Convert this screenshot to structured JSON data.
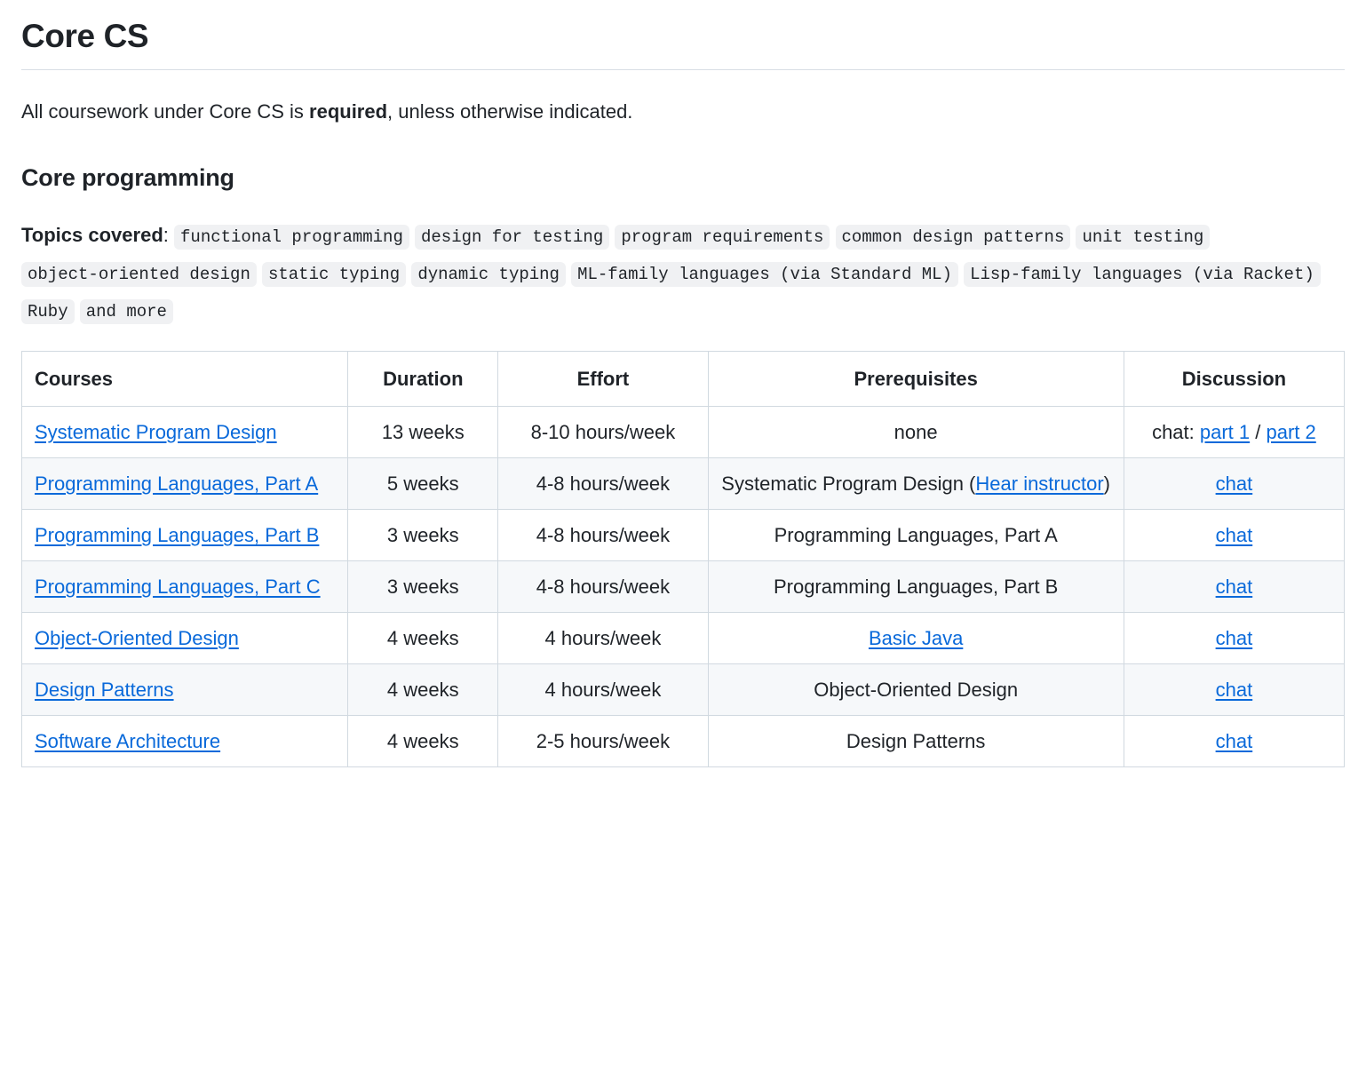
{
  "page": {
    "title": "Core CS",
    "intro_before": "All coursework under Core CS is ",
    "intro_strong": "required",
    "intro_after": ", unless otherwise indicated.",
    "section_title": "Core programming"
  },
  "topics": {
    "label": "Topics covered",
    "separator": ":",
    "tags": [
      "functional programming",
      "design for testing",
      "program requirements",
      "common design patterns",
      "unit testing",
      "object-oriented design",
      "static typing",
      "dynamic typing",
      "ML-family languages (via Standard ML)",
      "Lisp-family languages (via Racket)",
      "Ruby",
      "and more"
    ]
  },
  "table": {
    "headers": [
      "Courses",
      "Duration",
      "Effort",
      "Prerequisites",
      "Discussion"
    ],
    "rows": [
      {
        "course": "Systematic Program Design",
        "duration": "13 weeks",
        "effort": "8-10 hours/week",
        "prereq_text": "none",
        "prereq_link_before": "",
        "prereq_link": "",
        "prereq_link_after": "",
        "discussion_prefix": "chat: ",
        "discussion_link1": "part 1",
        "discussion_middle": " / ",
        "discussion_link2": "part 2"
      },
      {
        "course": "Programming Languages, Part A",
        "duration": "5 weeks",
        "effort": "4-8 hours/week",
        "prereq_text": "",
        "prereq_link_before": "Systematic Program Design (",
        "prereq_link": "Hear instructor",
        "prereq_link_after": ")",
        "discussion_prefix": "",
        "discussion_link1": "chat",
        "discussion_middle": "",
        "discussion_link2": ""
      },
      {
        "course": "Programming Languages, Part B",
        "duration": "3 weeks",
        "effort": "4-8 hours/week",
        "prereq_text": "Programming Languages, Part A",
        "prereq_link_before": "",
        "prereq_link": "",
        "prereq_link_after": "",
        "discussion_prefix": "",
        "discussion_link1": "chat",
        "discussion_middle": "",
        "discussion_link2": ""
      },
      {
        "course": "Programming Languages, Part C",
        "duration": "3 weeks",
        "effort": "4-8 hours/week",
        "prereq_text": "Programming Languages, Part B",
        "prereq_link_before": "",
        "prereq_link": "",
        "prereq_link_after": "",
        "discussion_prefix": "",
        "discussion_link1": "chat",
        "discussion_middle": "",
        "discussion_link2": ""
      },
      {
        "course": "Object-Oriented Design",
        "duration": "4 weeks",
        "effort": "4 hours/week",
        "prereq_text": "",
        "prereq_link_before": "",
        "prereq_link": "Basic Java",
        "prereq_link_after": "",
        "discussion_prefix": "",
        "discussion_link1": "chat",
        "discussion_middle": "",
        "discussion_link2": ""
      },
      {
        "course": "Design Patterns",
        "duration": "4 weeks",
        "effort": "4 hours/week",
        "prereq_text": "Object-Oriented Design",
        "prereq_link_before": "",
        "prereq_link": "",
        "prereq_link_after": "",
        "discussion_prefix": "",
        "discussion_link1": "chat",
        "discussion_middle": "",
        "discussion_link2": ""
      },
      {
        "course": "Software Architecture",
        "duration": "4 weeks",
        "effort": "2-5 hours/week",
        "prereq_text": "Design Patterns",
        "prereq_link_before": "",
        "prereq_link": "",
        "prereq_link_after": "",
        "discussion_prefix": "",
        "discussion_link1": "chat",
        "discussion_middle": "",
        "discussion_link2": ""
      }
    ]
  },
  "colors": {
    "link": "#0969da",
    "text": "#1f2328",
    "border": "#d1d9e0",
    "row_alt": "#f6f8fa",
    "tag_bg": "#f0f1f3"
  }
}
